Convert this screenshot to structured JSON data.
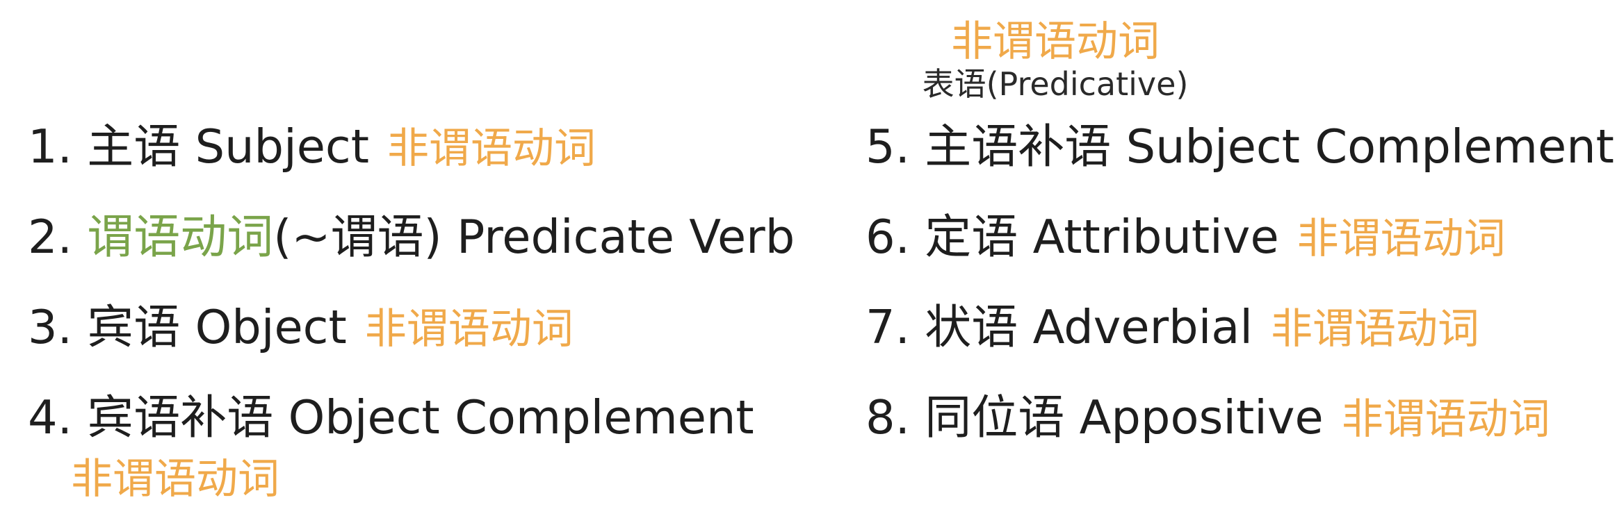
{
  "header": {
    "tag": "非谓语动词",
    "label": "表语(Predicative)"
  },
  "items": [
    {
      "num": "1.",
      "zh": "主语",
      "en": "Subject",
      "tag": "非谓语动词"
    },
    {
      "num": "2.",
      "zh_green": "谓语动词",
      "rest": "(~谓语) Predicate Verb"
    },
    {
      "num": "3.",
      "zh": "宾语",
      "en": "Object",
      "tag": "非谓语动词"
    },
    {
      "num": "4.",
      "zh": "宾语补语",
      "en": "Object Complement",
      "tag": "非谓语动词"
    },
    {
      "num": "5.",
      "zh": "主语补语",
      "en": "Subject Complement"
    },
    {
      "num": "6.",
      "zh": "定语",
      "en": "Attributive",
      "tag": "非谓语动词"
    },
    {
      "num": "7.",
      "zh": "状语",
      "en": "Adverbial",
      "tag": "非谓语动词"
    },
    {
      "num": "8.",
      "zh": "同位语",
      "en": "Appositive",
      "tag": "非谓语动词"
    }
  ],
  "colors": {
    "tag": "#f0a94a",
    "green": "#7aa44a",
    "text": "#1e1e1e"
  }
}
